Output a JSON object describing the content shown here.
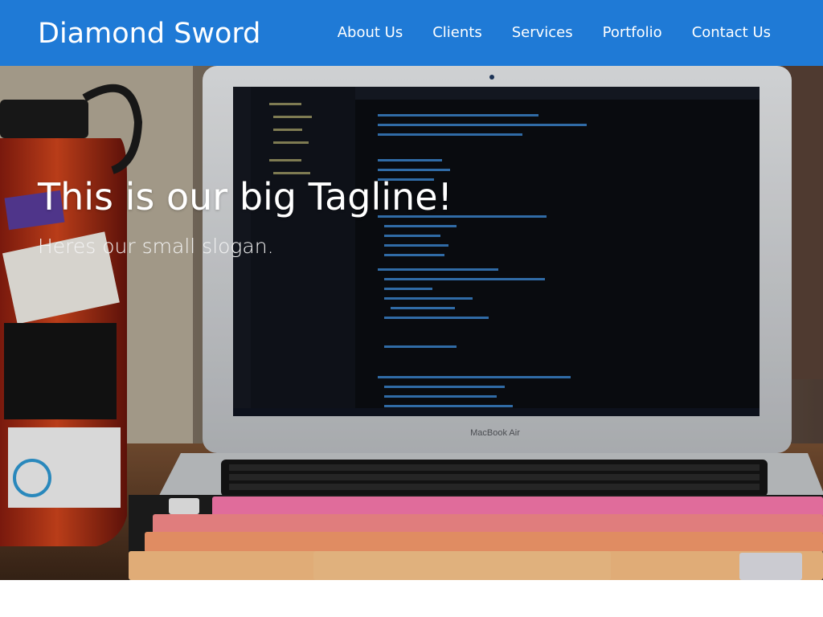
{
  "header": {
    "brand": "Diamond Sword",
    "nav": [
      {
        "label": "About Us"
      },
      {
        "label": "Clients"
      },
      {
        "label": "Services"
      },
      {
        "label": "Portfolio"
      },
      {
        "label": "Contact Us"
      }
    ]
  },
  "hero": {
    "tagline": "This is our big Tagline!",
    "slogan": "Heres our small slogan.",
    "laptop_label": "MacBook Air"
  },
  "colors": {
    "header_bg": "#1f7ad6",
    "text": "#ffffff",
    "laptop_silver": "#d9dadc",
    "screen": "#0b0d12",
    "keycap_pink": "#ff7bb1",
    "keycap_peach": "#ffb38a"
  }
}
